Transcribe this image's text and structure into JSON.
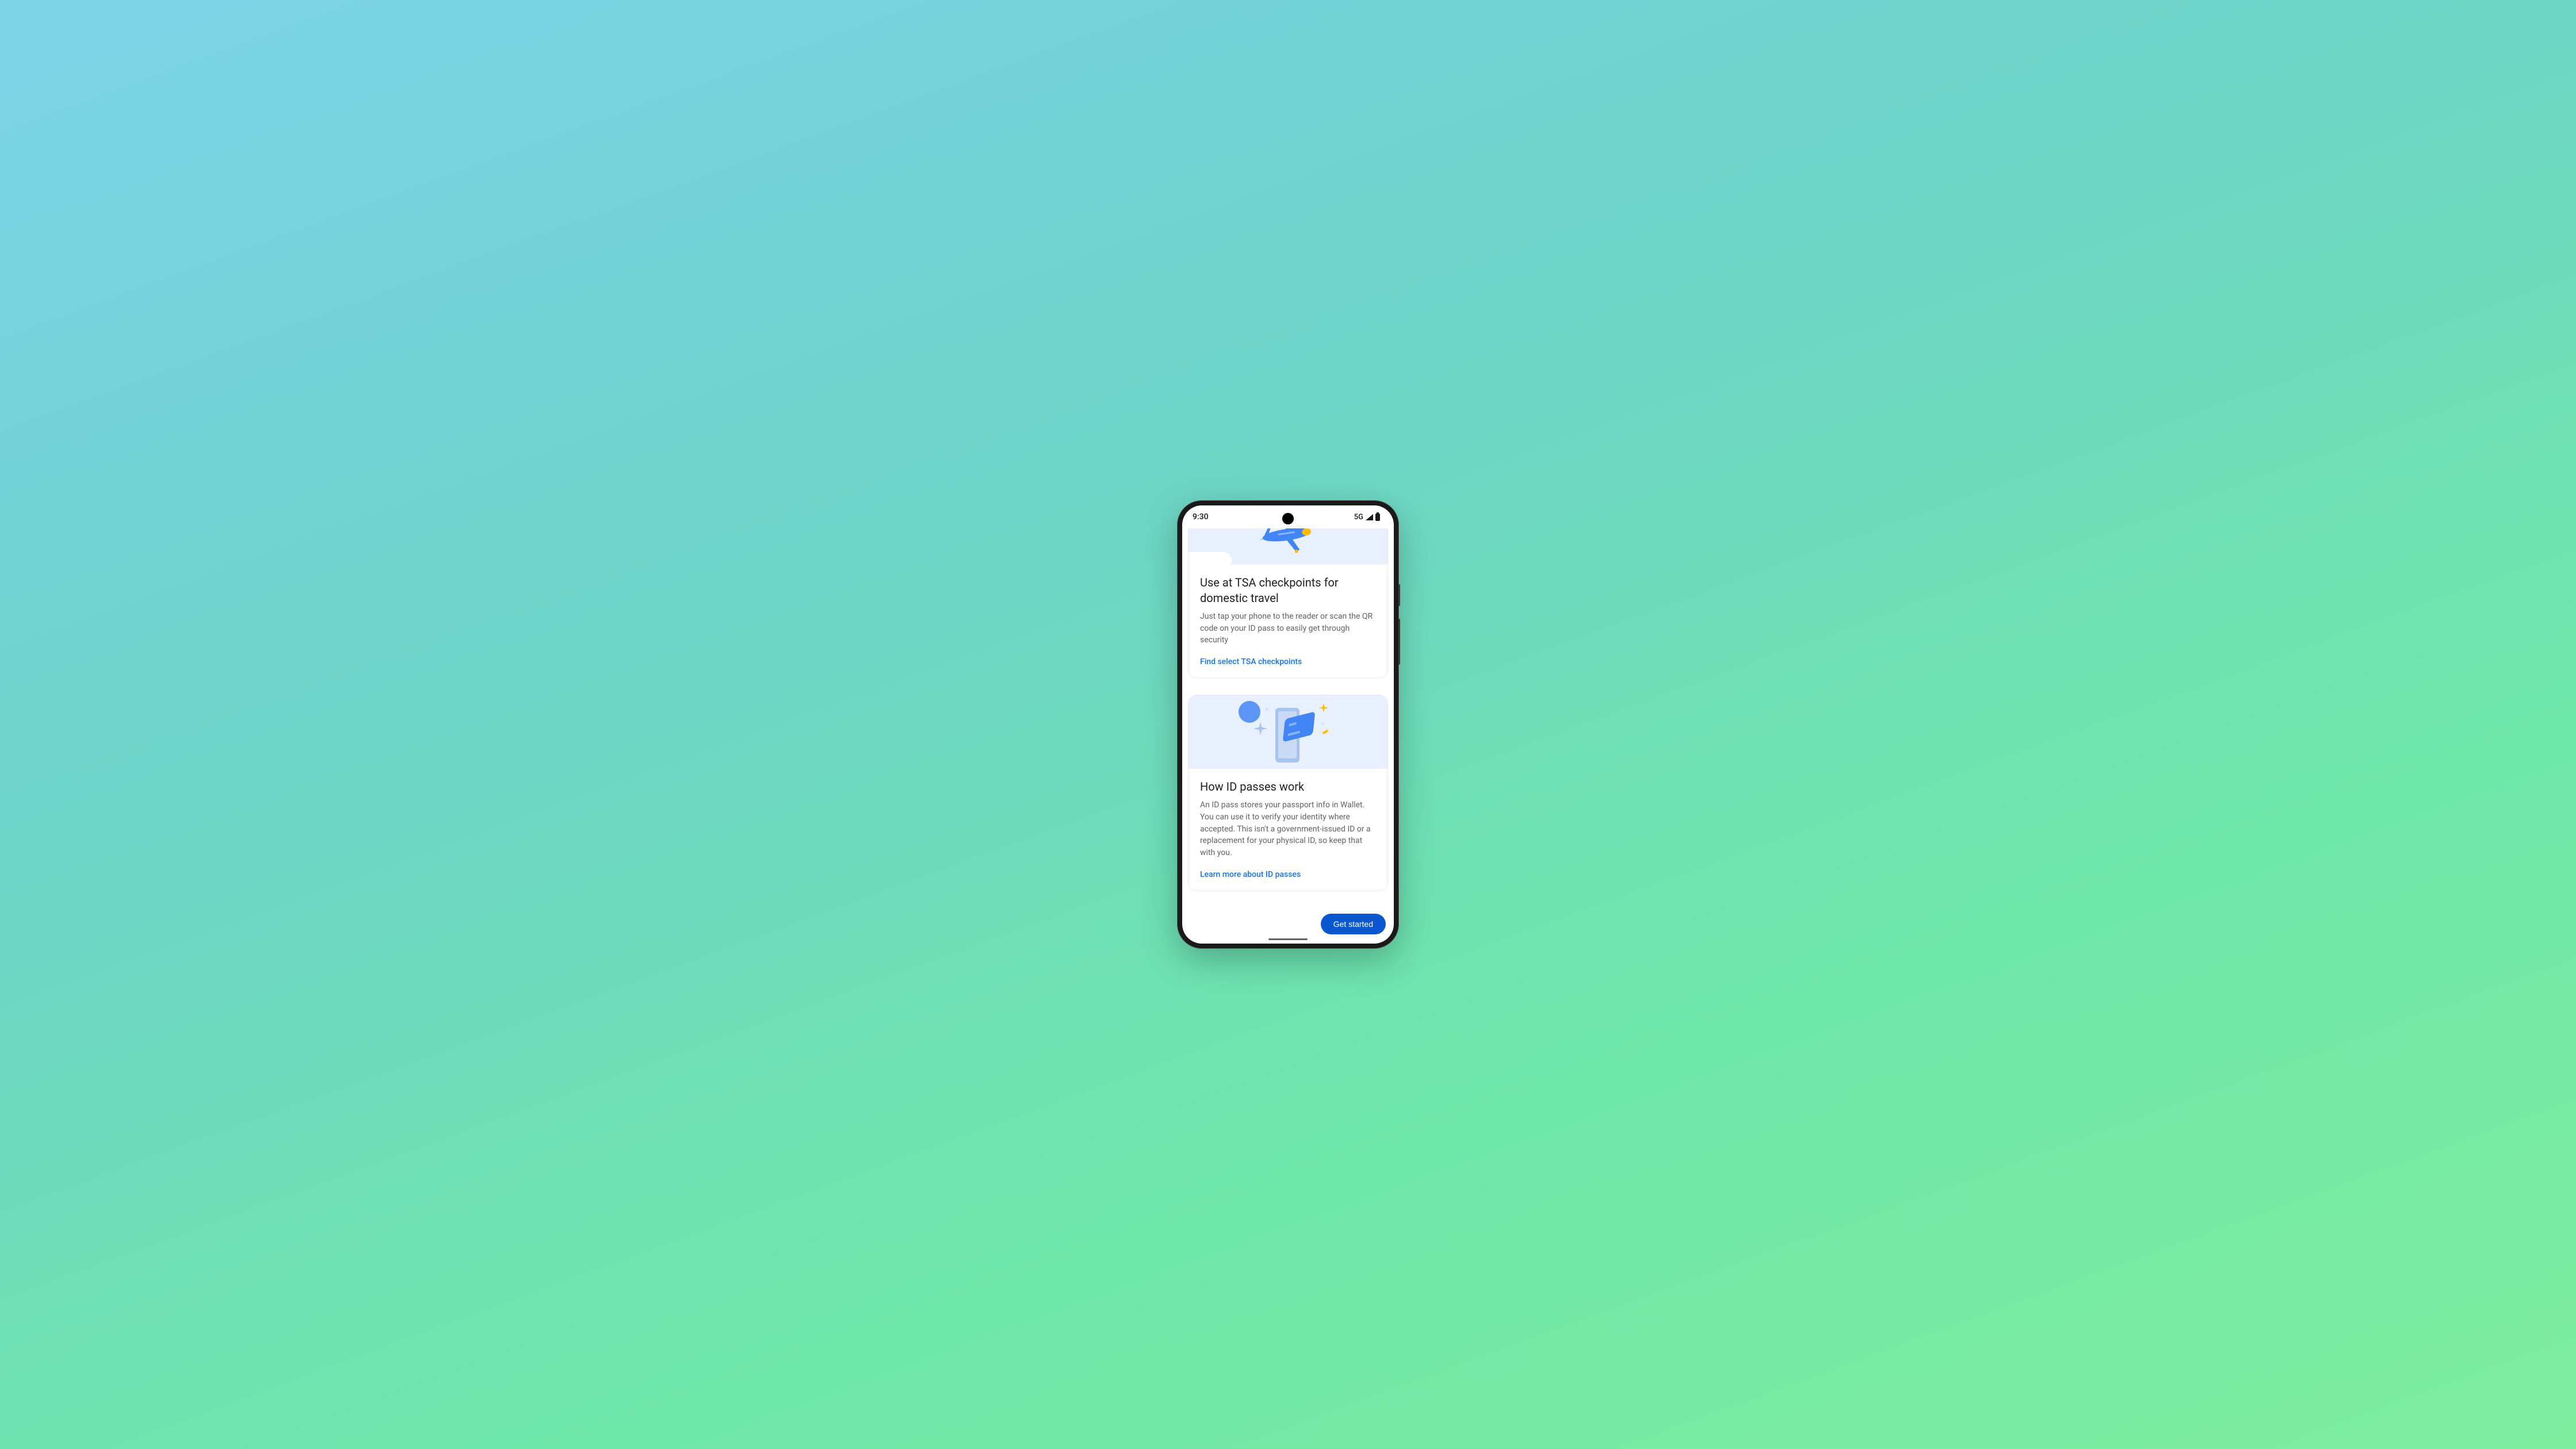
{
  "statusBar": {
    "time": "9:30",
    "network": "5G"
  },
  "cards": [
    {
      "title": "Use at TSA checkpoints for domestic travel",
      "description": "Just tap your phone to the reader or scan the QR code on your ID pass to easily get through security",
      "link": "Find select TSA checkpoints"
    },
    {
      "title": "How ID passes work",
      "description": "An ID pass stores your passport info in Wallet. You can use it to verify your identity where accepted. This isn't a government-issued ID or a replacement for your physical ID, so keep that with you.",
      "link": "Learn more about ID passes"
    }
  ],
  "footer": {
    "primaryAction": "Get started"
  },
  "colors": {
    "linkBlue": "#1a73e8",
    "primaryButton": "#0b57d0",
    "illustrationBg": "#e8f0fe",
    "accentYellow": "#fbbc04"
  }
}
